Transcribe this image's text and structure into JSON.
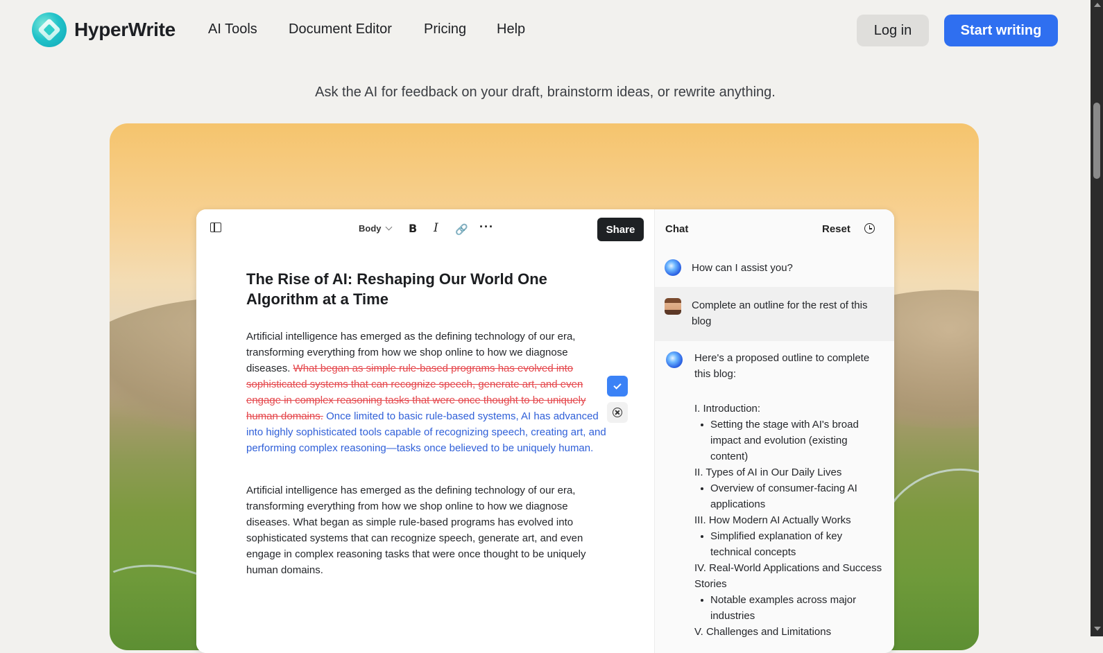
{
  "nav": {
    "brand": "HyperWrite",
    "links": [
      "AI Tools",
      "Document Editor",
      "Pricing",
      "Help"
    ],
    "login": "Log in",
    "cta": "Start writing"
  },
  "subtitle": "Ask the AI for feedback on your draft, brainstorm ideas, or rewrite anything.",
  "editor": {
    "toolbar": {
      "style": "Body",
      "share": "Share"
    },
    "title": "The Rise of AI: Reshaping Our World One Algorithm at a Time",
    "p1_plain": "Artificial intelligence has emerged as the defining technology of our era, transforming everything from how we shop online to how we diagnose diseases. ",
    "p1_deleted": "What began as simple rule-based programs has evolved into sophisticated systems that can recognize speech, generate art, and even engage in complex reasoning tasks that were once thought to be uniquely human domains.",
    "p1_inserted": " Once limited to basic rule-based systems, AI has advanced into highly sophisticated tools capable of recognizing speech, creating art, and performing complex reasoning—tasks once believed to be uniquely human.",
    "p2": "Artificial intelligence has emerged as the defining technology of our era, transforming everything from how we shop online to how we diagnose diseases. What began as simple rule-based programs has evolved into sophisticated systems that can recognize speech, generate art, and even engage in complex reasoning tasks that were once thought to be uniquely human domains."
  },
  "chat": {
    "title": "Chat",
    "reset": "Reset",
    "messages": [
      {
        "role": "ai",
        "text": "How can I assist you?"
      },
      {
        "role": "user",
        "text": "Complete an outline for the rest of this blog"
      },
      {
        "role": "ai",
        "text": "Here's a proposed outline to complete this blog:"
      }
    ],
    "outline": [
      {
        "heading": "I. Introduction:",
        "bullet": "Setting the stage with AI's broad impact and evolution (existing content)"
      },
      {
        "heading": "II. Types of AI in Our Daily Lives",
        "bullet": "Overview of consumer-facing AI applications"
      },
      {
        "heading": "III. How Modern AI Actually Works",
        "bullet": "Simplified explanation of key technical concepts"
      },
      {
        "heading": "IV. Real-World Applications and Success Stories",
        "bullet": "Notable examples across major industries"
      },
      {
        "heading": "V. Challenges and Limitations"
      }
    ]
  },
  "colors": {
    "accent": "#2f6ff0",
    "deleted": "#e5484d",
    "inserted": "#2f5fd8"
  }
}
